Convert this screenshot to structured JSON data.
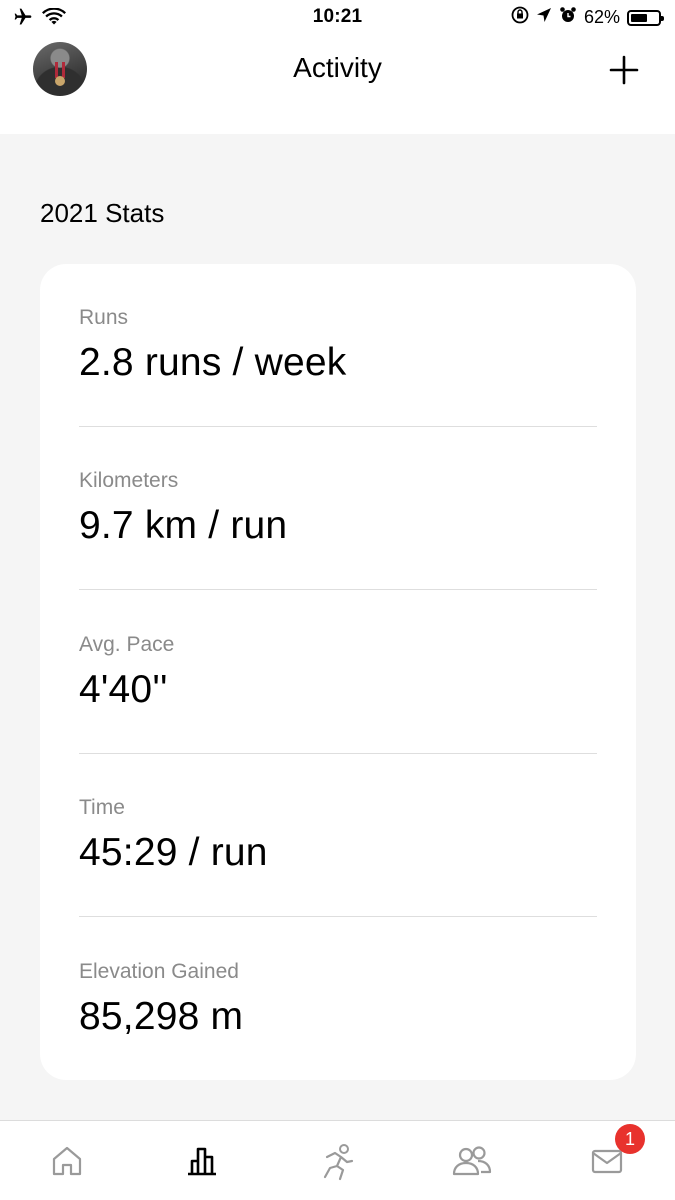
{
  "status_bar": {
    "time": "10:21",
    "battery_percent": "62%",
    "battery_level": 0.62,
    "icons": [
      "airplane-icon",
      "wifi-icon",
      "orientation-lock-icon",
      "location-icon",
      "alarm-icon",
      "battery-icon"
    ]
  },
  "header": {
    "title": "Activity",
    "add_icon": "plus-icon"
  },
  "section_title": "2021 Stats",
  "stats": [
    {
      "label": "Runs",
      "value": "2.8 runs / week"
    },
    {
      "label": "Kilometers",
      "value": "9.7 km / run"
    },
    {
      "label": "Avg. Pace",
      "value": "4'40''"
    },
    {
      "label": "Time",
      "value": "45:29 / run"
    },
    {
      "label": "Elevation Gained",
      "value": "85,298 m"
    }
  ],
  "tab_bar": {
    "tabs": [
      {
        "icon": "home-icon",
        "active": false
      },
      {
        "icon": "bar-chart-icon",
        "active": true
      },
      {
        "icon": "run-icon",
        "active": false
      },
      {
        "icon": "people-icon",
        "active": false
      },
      {
        "icon": "inbox-icon",
        "active": false
      }
    ],
    "inbox_badge": "1"
  },
  "colors": {
    "background": "#f5f5f5",
    "card": "#ffffff",
    "label_gray": "#8a8a8a",
    "inactive_icon": "#9a9a9a",
    "badge": "#e8322d"
  }
}
